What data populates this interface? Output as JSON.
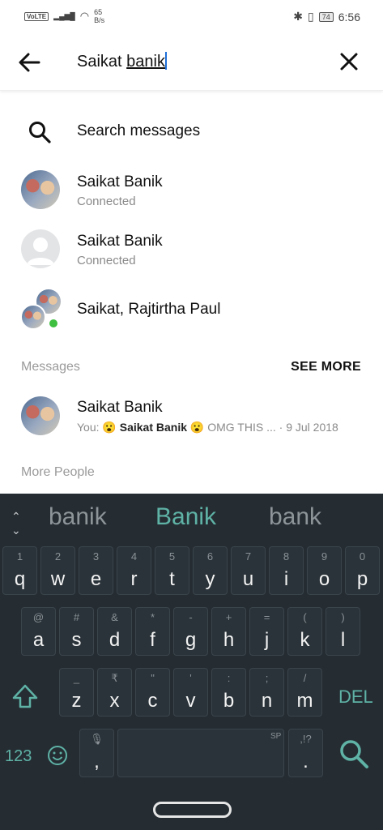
{
  "status": {
    "network": "VoLTE",
    "signal": "4G",
    "speed_value": "65",
    "speed_unit": "B/s",
    "battery": "74",
    "time": "6:56"
  },
  "search": {
    "query_plain": "Saikat ",
    "query_underlined": "banik"
  },
  "search_messages_label": "Search messages",
  "contacts": [
    {
      "name": "Saikat Banik",
      "status": "Connected"
    },
    {
      "name": "Saikat Banik",
      "status": "Connected"
    },
    {
      "name": "Saikat, Rajtirtha Paul"
    }
  ],
  "messages_section": {
    "label": "Messages",
    "see_more": "SEE MORE"
  },
  "message": {
    "name": "Saikat Banik",
    "you": "You: 😮",
    "bold": "Saikat Banik",
    "rest": "😮 OMG THIS ...",
    "date": "· 9 Jul 2018"
  },
  "more_people_label": "More People",
  "keyboard": {
    "suggestions": [
      "banik",
      "Banik",
      "bank"
    ],
    "row1": [
      [
        "1",
        "q"
      ],
      [
        "2",
        "w"
      ],
      [
        "3",
        "e"
      ],
      [
        "4",
        "r"
      ],
      [
        "5",
        "t"
      ],
      [
        "6",
        "y"
      ],
      [
        "7",
        "u"
      ],
      [
        "8",
        "i"
      ],
      [
        "9",
        "o"
      ],
      [
        "0",
        "p"
      ]
    ],
    "row2": [
      [
        "@",
        "a"
      ],
      [
        "#",
        "s"
      ],
      [
        "&",
        "d"
      ],
      [
        "*",
        "f"
      ],
      [
        "-",
        "g"
      ],
      [
        "+",
        "h"
      ],
      [
        "=",
        "j"
      ],
      [
        "(",
        "k"
      ],
      [
        ")",
        "l"
      ]
    ],
    "row3": [
      [
        "_",
        "z"
      ],
      [
        "₹",
        "x"
      ],
      [
        "\"",
        "c"
      ],
      [
        "'",
        "v"
      ],
      [
        ":",
        "b"
      ],
      [
        ";",
        "n"
      ],
      [
        "/",
        "m"
      ]
    ],
    "del": "DEL",
    "num": "123",
    "comma": ",",
    "period": ".",
    "period_hint": ",!?",
    "sp": "SP"
  }
}
